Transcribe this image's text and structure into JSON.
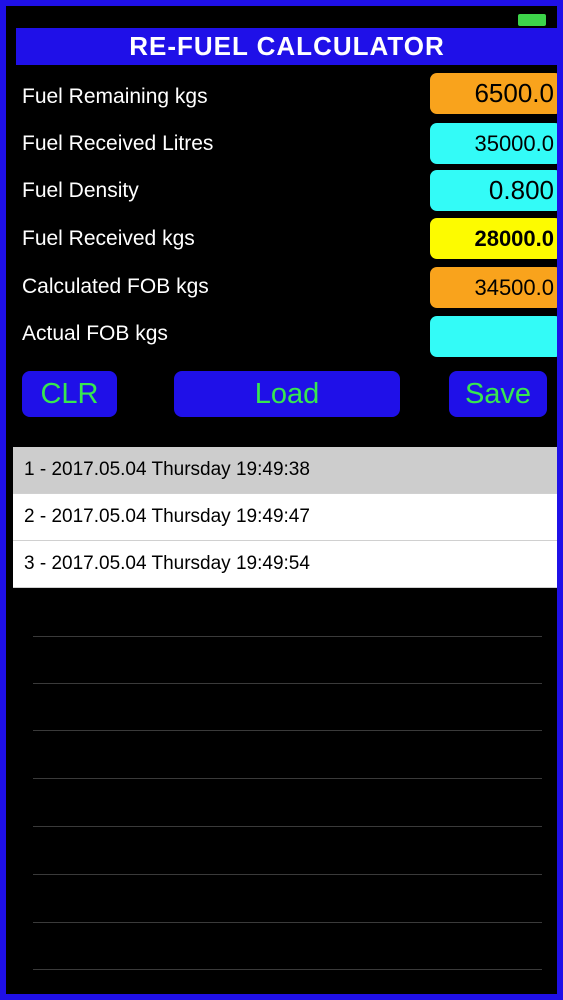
{
  "app": {
    "title": "RE-FUEL CALCULATOR"
  },
  "fields": [
    {
      "label": "Fuel Remaining kgs",
      "value": "6500.0",
      "color": "#f9a31c"
    },
    {
      "label": "Fuel Received Litres",
      "value": "35000.0",
      "color": "#33fbf7"
    },
    {
      "label": "Fuel Density",
      "value": "0.800",
      "color": "#33fbf7"
    },
    {
      "label": "Fuel Received kgs",
      "value": "28000.0",
      "color": "#fdfb00"
    },
    {
      "label": "Calculated FOB kgs",
      "value": "34500.0",
      "color": "#f9a31c"
    },
    {
      "label": "Actual FOB kgs",
      "value": "",
      "color": "#33fbf7"
    }
  ],
  "buttons": {
    "clear": "CLR",
    "load": "Load",
    "save": "Save"
  },
  "records": [
    "1 - 2017.05.04 Thursday 19:49:38",
    "2 - 2017.05.04 Thursday 19:49:47",
    "3 - 2017.05.04 Thursday 19:49:54"
  ],
  "selected_record": 0,
  "colors": {
    "frame": "#1f10e8",
    "button_text": "#37e74f",
    "battery": "#3dd44a"
  }
}
